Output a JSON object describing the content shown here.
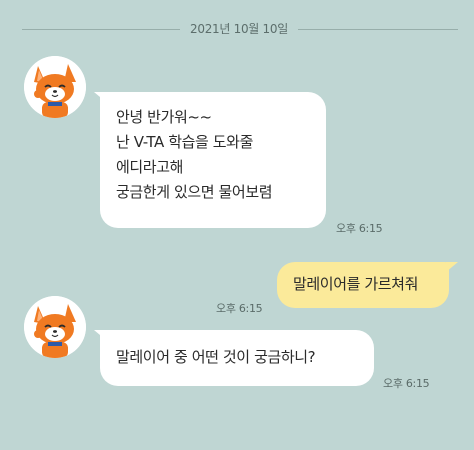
{
  "date_divider": "2021년 10월 10일",
  "messages": [
    {
      "sender": "bot",
      "lines": [
        "안녕 반가워~~",
        "난 V-TA 학습을 도와줄",
        "에디라고해",
        "궁금한게 있으면 물어보렴"
      ],
      "time": "오후 6:15"
    },
    {
      "sender": "user",
      "text": "말레이어를 가르쳐줘",
      "time": "오후 6:15"
    },
    {
      "sender": "bot",
      "text": "말레이어 중 어떤 것이 궁금하니?",
      "time": "오후 6:15"
    }
  ],
  "avatar_icon": "fox-mascot-icon",
  "colors": {
    "background": "#bfd6d3",
    "incoming_bubble": "#ffffff",
    "outgoing_bubble": "#fbea9a"
  }
}
